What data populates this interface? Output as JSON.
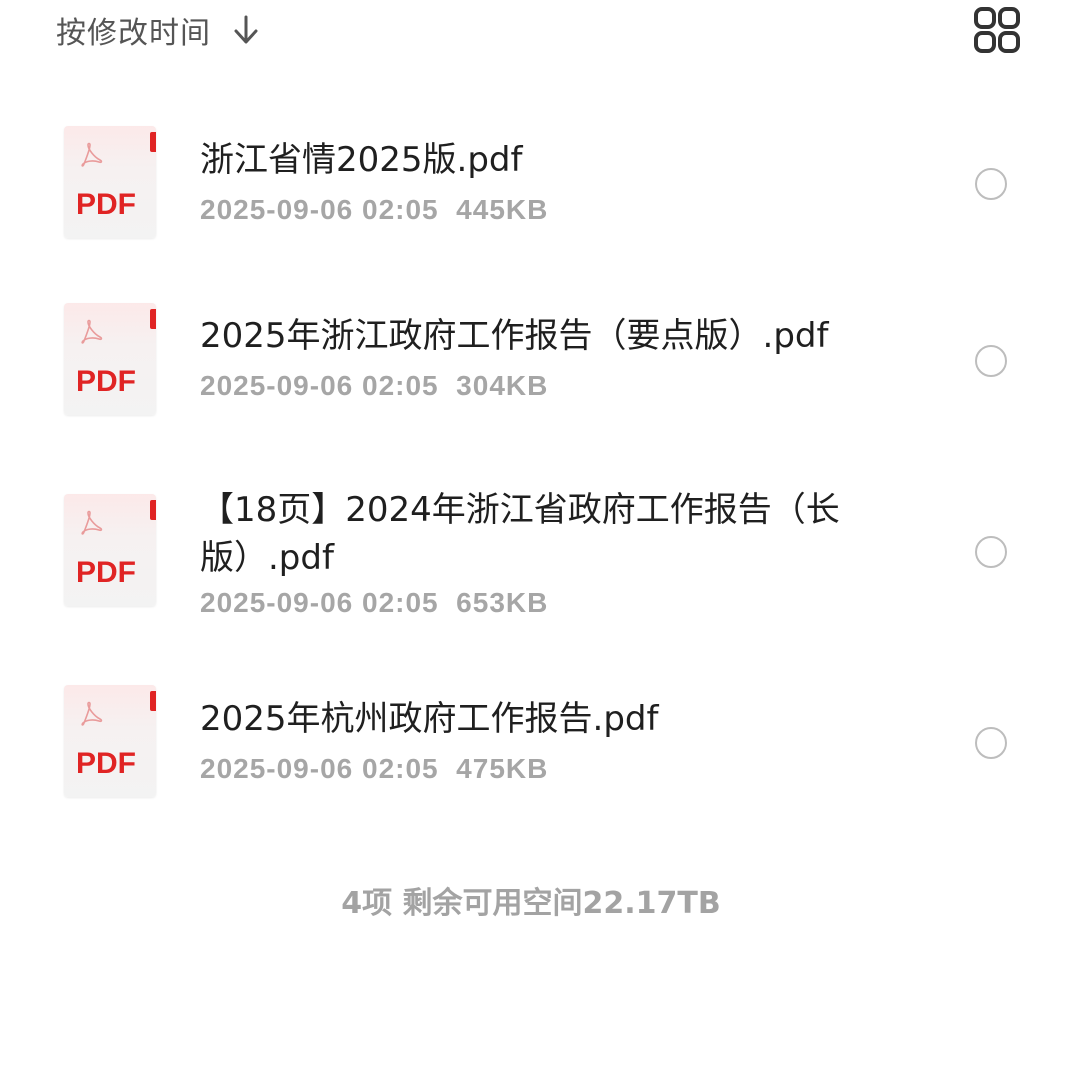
{
  "header": {
    "sort_label": "按修改时间",
    "sort_icon": "arrow-down-icon",
    "view_toggle_icon": "grid-view-icon"
  },
  "files": [
    {
      "name": "浙江省情2025版.pdf",
      "meta": "2025-09-06 02:05  445KB",
      "type_label": "PDF"
    },
    {
      "name": "2025年浙江政府工作报告（要点版）.pdf",
      "meta": "2025-09-06 02:05  304KB",
      "type_label": "PDF"
    },
    {
      "name": "【18页】2024年浙江省政府工作报告（长版）.pdf",
      "meta": "2025-09-06 02:05  653KB",
      "type_label": "PDF"
    },
    {
      "name": "2025年杭州政府工作报告.pdf",
      "meta": "2025-09-06 02:05  475KB",
      "type_label": "PDF"
    }
  ],
  "footer": {
    "summary": "4项 剩余可用空间22.17TB"
  },
  "colors": {
    "pdf_red": "#e02424",
    "meta_gray": "#a6a6a6",
    "radio_border": "#bdbdbd"
  }
}
